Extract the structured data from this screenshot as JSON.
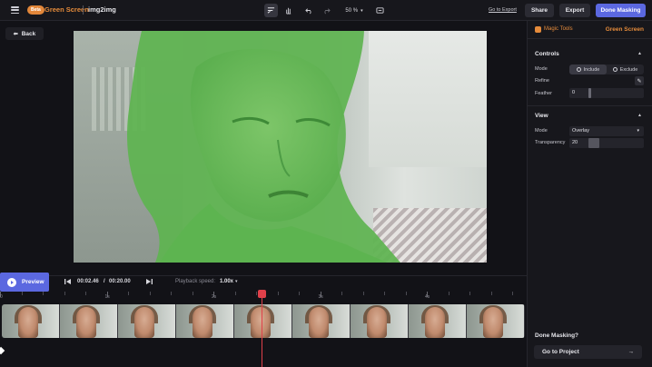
{
  "header": {
    "badge": "Beta",
    "app_title": "Green Screen",
    "file_name": "img2img",
    "zoom": "50 %",
    "go_to_export": "Go to Export",
    "share": "Share",
    "export": "Export",
    "done_masking": "Done Masking"
  },
  "canvas": {
    "back_label": "Back",
    "mask_color": "#4caf50"
  },
  "playback": {
    "preview_label": "Preview",
    "current_time": "00:02.46",
    "separator": "/",
    "total_time": "00:20.00",
    "speed_label": "Playback speed:",
    "speed_value": "1.00x",
    "ruler_labels": [
      "0",
      "1s",
      "2s",
      "3s",
      "4s"
    ],
    "frame_count": 9,
    "playhead_color": "#e0404a"
  },
  "panel": {
    "tool_name": "Magic Tools",
    "tool_mode": "Green Screen",
    "controls": {
      "title": "Controls",
      "mode_label": "Mode",
      "include": "Include",
      "exclude": "Exclude",
      "refine_label": "Refine",
      "feather_label": "Feather",
      "feather_value": "0"
    },
    "view": {
      "title": "View",
      "mode_label": "Mode",
      "mode_value": "Overlay",
      "transparency_label": "Transparency",
      "transparency_value": "20"
    },
    "done_question": "Done Masking?",
    "go_to_project": "Go to Project"
  },
  "colors": {
    "accent": "#5b68e0",
    "brand": "#e58b3b"
  }
}
